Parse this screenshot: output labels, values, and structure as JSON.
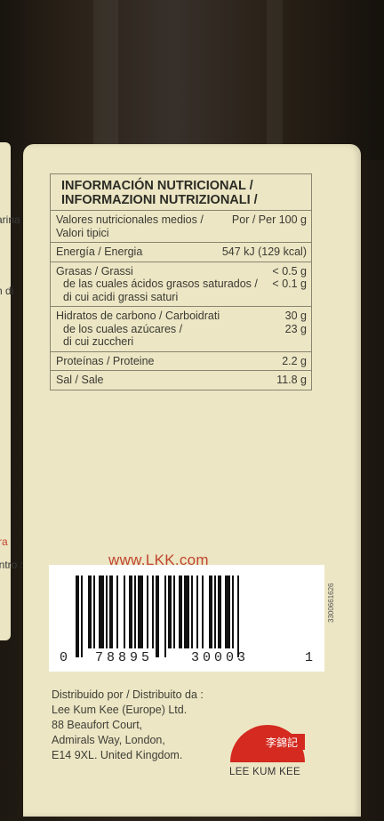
{
  "left_panel_fragments": [
    "arina",
    "n di",
    "ra",
    "entro :"
  ],
  "nutrition": {
    "title_es": "INFORMACIÓN NUTRICIONAL /",
    "title_it": "INFORMAZIONI NUTRIZIONALI /",
    "rows": [
      {
        "lines": [
          "Valores nutricionales medios /",
          "Valori tipici"
        ],
        "values": [
          "Por / Per 100 g"
        ]
      },
      {
        "lines": [
          "Energía / Energia"
        ],
        "values": [
          "547 kJ (129 kcal)"
        ]
      },
      {
        "lines": [
          "Grasas / Grassi",
          "de las cuales ácidos grasos saturados /",
          "di cui acidi grassi saturi"
        ],
        "values": [
          "< 0.5 g",
          "< 0.1 g"
        ]
      },
      {
        "lines": [
          "Hidratos de carbono / Carboidrati",
          "de los cuales azúcares /",
          "di cui zuccheri"
        ],
        "values": [
          "30 g",
          "23 g"
        ]
      },
      {
        "lines": [
          "Proteínas / Proteine"
        ],
        "values": [
          "2.2 g"
        ]
      },
      {
        "lines": [
          "Sal / Sale"
        ],
        "values": [
          "11.8 g"
        ]
      }
    ]
  },
  "website": "www.LKK.com",
  "barcode": {
    "first_digit": "0",
    "left_group": "78895",
    "right_group": "30003",
    "check_digit": "1"
  },
  "side_code": "3300661626",
  "distributor": {
    "label": "Distribuido por / Distribuito da :",
    "lines": [
      "Lee Kum Kee (Europe) Ltd.",
      "88 Beaufort Court,",
      "Admirals Way, London,",
      "E14 9XL. United Kingdom."
    ]
  },
  "logo": {
    "chinese": "李錦記",
    "name": "LEE KUM KEE",
    "color": "#d42a1f"
  }
}
